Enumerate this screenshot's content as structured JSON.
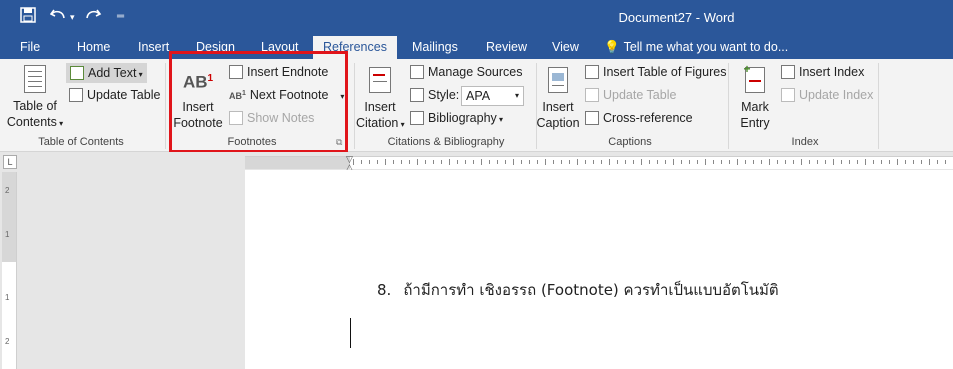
{
  "window": {
    "title": "Document27  -  Word"
  },
  "quick_access": {
    "save_icon": "save-icon",
    "undo_icon": "undo-icon",
    "redo_icon": "redo-icon",
    "customize_icon": "customize-qat-icon"
  },
  "tabs": [
    {
      "label": "File"
    },
    {
      "label": "Home"
    },
    {
      "label": "Insert"
    },
    {
      "label": "Design"
    },
    {
      "label": "Layout"
    },
    {
      "label": "References"
    },
    {
      "label": "Mailings"
    },
    {
      "label": "Review"
    },
    {
      "label": "View"
    }
  ],
  "tell_me": "Tell me what you want to do...",
  "ribbon": {
    "toc": {
      "group_label": "Table of Contents",
      "toc_line1": "Table of",
      "toc_line2": "Contents",
      "add_text": "Add Text",
      "update_table": "Update Table"
    },
    "footnotes": {
      "group_label": "Footnotes",
      "insert_line1": "Insert",
      "insert_line2": "Footnote",
      "insert_endnote": "Insert Endnote",
      "next_footnote": "Next Footnote",
      "show_notes": "Show Notes",
      "icon_text": "AB",
      "icon_sup": "1",
      "next_icon_text": "AB",
      "next_icon_sup": "1"
    },
    "citations": {
      "group_label": "Citations & Bibliography",
      "insert_line1": "Insert",
      "insert_line2": "Citation",
      "manage_sources": "Manage Sources",
      "style_label": "Style:",
      "style_value": "APA",
      "bibliography": "Bibliography"
    },
    "captions": {
      "group_label": "Captions",
      "insert_line1": "Insert",
      "insert_line2": "Caption",
      "insert_tof": "Insert Table of Figures",
      "update_table": "Update Table",
      "cross_reference": "Cross-reference"
    },
    "index": {
      "group_label": "Index",
      "mark_line1": "Mark",
      "mark_line2": "Entry",
      "insert_index": "Insert Index",
      "update_index": "Update Index"
    }
  },
  "rulers": {
    "tab_selector": "L",
    "vertical_numbers": [
      "2",
      "1",
      "1",
      "2"
    ]
  },
  "document": {
    "item_number": "8.",
    "item_text": "ถ้ามีการทำ เชิงอรรถ (Footnote) ควรทำเป็นแบบอัตโนมัติ"
  },
  "colors": {
    "accent": "#2b579a",
    "highlight": "#e0141a",
    "ribbon_bg": "#f3f3f3"
  }
}
